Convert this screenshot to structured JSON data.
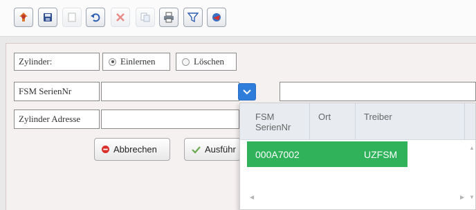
{
  "toolbar": {
    "buttons": [
      {
        "name": "new-icon",
        "enabled": true
      },
      {
        "name": "save-icon",
        "enabled": true
      },
      {
        "name": "blank-page-icon",
        "enabled": false
      },
      {
        "name": "undo-icon",
        "enabled": true
      },
      {
        "name": "delete-icon",
        "enabled": false
      },
      {
        "name": "copy-icon",
        "enabled": false
      },
      {
        "name": "print-icon",
        "enabled": true
      },
      {
        "name": "filter-icon",
        "enabled": true
      },
      {
        "name": "export-icon",
        "enabled": true
      }
    ]
  },
  "form": {
    "zylinder_label": "Zylinder:",
    "option_einlernen": "Einlernen",
    "option_loeschen": "Löschen",
    "selected_option": "Einlernen",
    "fsm_label": "FSM SerienNr",
    "fsm_value": "",
    "zylinder_adresse_label": "Zylinder Adresse",
    "zylinder_adresse_value": "",
    "extra_field_value": ""
  },
  "buttons": {
    "cancel_label": "Abbrechen",
    "execute_label": "Ausführ"
  },
  "dropdown": {
    "columns": [
      "FSM SerienNr",
      "Ort",
      "Treiber"
    ],
    "rows": [
      {
        "fsm": "000A7002",
        "ort": "",
        "treiber": "UZFSM"
      }
    ]
  },
  "colors": {
    "accent_blue": "#2f7ddb",
    "selected_row_green": "#2fb25a",
    "cancel_red": "#d9302b",
    "check_green": "#6aa84f"
  }
}
